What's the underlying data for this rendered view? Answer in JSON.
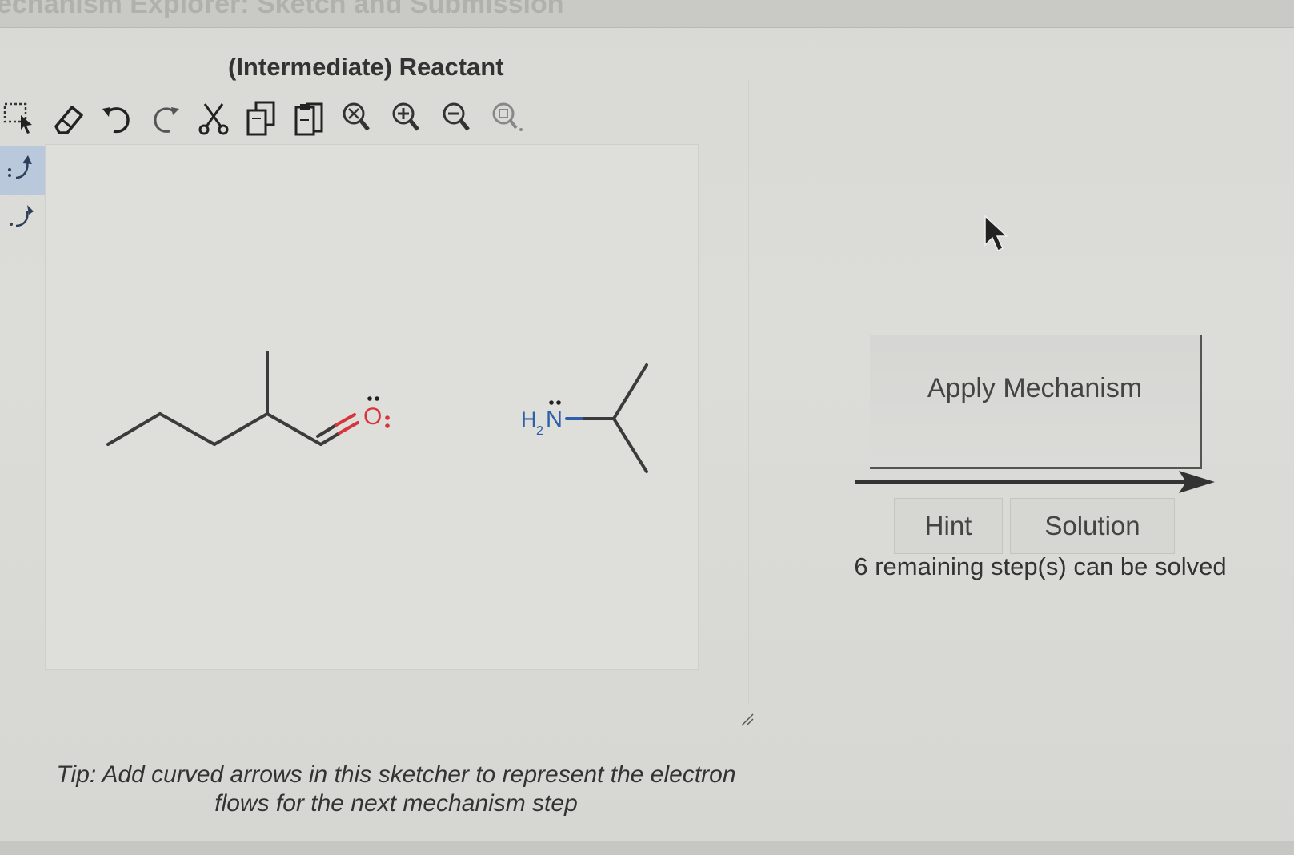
{
  "window": {
    "title": "echanism Explorer: Sketch and Submission"
  },
  "panel": {
    "title": "(Intermediate) Reactant"
  },
  "toolbar": {
    "tools": [
      {
        "name": "select-icon"
      },
      {
        "name": "eraser-icon"
      },
      {
        "name": "undo-icon"
      },
      {
        "name": "redo-icon"
      },
      {
        "name": "cut-icon"
      },
      {
        "name": "copy-icon"
      },
      {
        "name": "paste-icon"
      },
      {
        "name": "zoom-reset-icon"
      },
      {
        "name": "zoom-in-icon"
      },
      {
        "name": "zoom-out-icon"
      },
      {
        "name": "zoom-fit-icon"
      }
    ]
  },
  "side_tools": [
    {
      "name": "electron-pair-arrow-icon",
      "active": true
    },
    {
      "name": "single-electron-arrow-icon",
      "active": false
    }
  ],
  "molecules": {
    "aldehyde": {
      "atom_label": "O",
      "color": "#d9343c"
    },
    "amine": {
      "label_h": "H",
      "label_sub": "2",
      "label_n": "N",
      "color": "#2f5fa8"
    }
  },
  "tip": {
    "line1": "Tip: Add curved arrows in this sketcher to represent the electron",
    "line2": "flows for the next mechanism step"
  },
  "actions": {
    "apply_label": "Apply Mechanism",
    "hint_label": "Hint",
    "solution_label": "Solution",
    "remaining_text": "6 remaining step(s) can be solved"
  }
}
